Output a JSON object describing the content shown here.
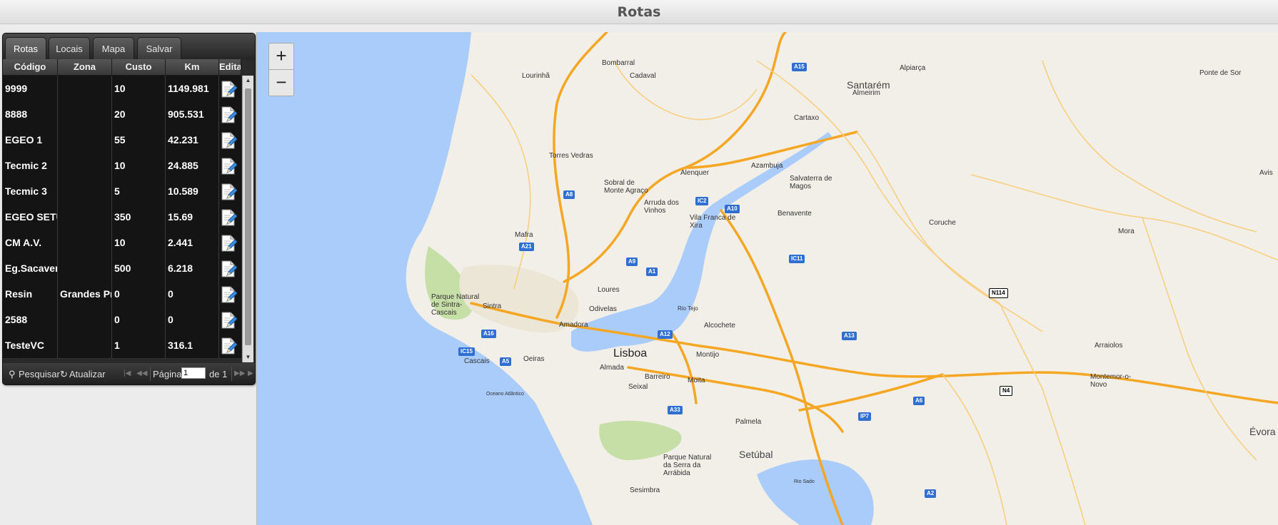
{
  "window": {
    "title": "Rotas"
  },
  "tabs": [
    {
      "label": "Rotas",
      "active": true
    },
    {
      "label": "Locais"
    },
    {
      "label": "Mapa"
    },
    {
      "label": "Salvar"
    }
  ],
  "columns": [
    "Código",
    "Zona",
    "Custo",
    "Km",
    "Edita"
  ],
  "rows": [
    {
      "codigo": "9999",
      "zona": "",
      "custo": "10",
      "km": "1149.981"
    },
    {
      "codigo": "8888",
      "zona": "",
      "custo": "20",
      "km": "905.531"
    },
    {
      "codigo": "EGEO 1",
      "zona": "",
      "custo": "55",
      "km": "42.231"
    },
    {
      "codigo": "Tecmic 2",
      "zona": "",
      "custo": "10",
      "km": "24.885"
    },
    {
      "codigo": "Tecmic 3",
      "zona": "",
      "custo": "5",
      "km": "10.589"
    },
    {
      "codigo": "EGEO SETUI",
      "zona": "",
      "custo": "350",
      "km": "15.69"
    },
    {
      "codigo": "CM A.V.",
      "zona": "",
      "custo": "10",
      "km": "2.441"
    },
    {
      "codigo": "Eg.Sacavem",
      "zona": "",
      "custo": "500",
      "km": "6.218"
    },
    {
      "codigo": "Resin",
      "zona": "Grandes Pro",
      "custo": "0",
      "km": "0"
    },
    {
      "codigo": "2588",
      "zona": "",
      "custo": "0",
      "km": "0"
    },
    {
      "codigo": "TesteVC",
      "zona": "",
      "custo": "1",
      "km": "316.1"
    }
  ],
  "pager": {
    "search_label": "Pesquisar",
    "refresh_label": "Atualizar",
    "page_label": "Página",
    "page_value": "1",
    "of_label": "de 1"
  },
  "map": {
    "zoom_in": "+",
    "zoom_out": "−",
    "places": {
      "santarem": "Santarém",
      "almeirim": "Almeirim",
      "alpiarca": "Alpiarça",
      "ponte_de_sor": "Ponte de Sor",
      "bombarral": "Bombarral",
      "cadaval": "Cadaval",
      "lourinha": "Lourinhã",
      "cartaxo": "Cartaxo",
      "torres_vedras": "Torres Vedras",
      "alenquer": "Alenquer",
      "azambuja": "Azambuja",
      "salvaterra": "Salvaterra de\nMagos",
      "sobral": "Sobral de\nMonte Agraço",
      "arruda": "Arruda dos\nVinhos",
      "vila_franca": "Vila Franca de\nXira",
      "benavente": "Benavente",
      "coruche": "Coruche",
      "mora": "Mora",
      "avis": "Avis",
      "mafra": "Mafra",
      "loures": "Loures",
      "odivelas": "Odivelas",
      "sintra": "Sintra",
      "parque_sintra": "Parque Natural\nde Sintra-\nCascais",
      "amadora": "Amadora",
      "rio_tejo": "Rio Tejo",
      "alcochete": "Alcochete",
      "lisboa": "Lisboa",
      "almada": "Almada",
      "montijo": "Montijo",
      "barreiro": "Barreiro",
      "moita": "Moita",
      "seixal": "Seixal",
      "cascais": "Cascais",
      "oeiras": "Oeiras",
      "oceano": "Oceano Atlântico",
      "palmela": "Palmela",
      "setubal": "Setúbal",
      "parque_arrabida": "Parque Natural\nda Serra da\nArrábida",
      "sesimbra": "Sesimbra",
      "rio_sado": "Rio Sado",
      "arraiolos": "Arraiolos",
      "montemor": "Montemor-o-\nNovo",
      "evora": "Évora"
    },
    "shields": {
      "a15": "A15",
      "a8": "A8",
      "ic2": "IC2",
      "a10": "A10",
      "a21": "A21",
      "a9": "A9",
      "a1": "A1",
      "ic11": "IC11",
      "n114": "N114",
      "a16": "A16",
      "a12": "A12",
      "a13": "A13",
      "ic15": "IC15",
      "a5": "A5",
      "a33": "A33",
      "a6": "A6",
      "n4": "N4",
      "ip7": "IP7",
      "a2": "A2"
    }
  }
}
